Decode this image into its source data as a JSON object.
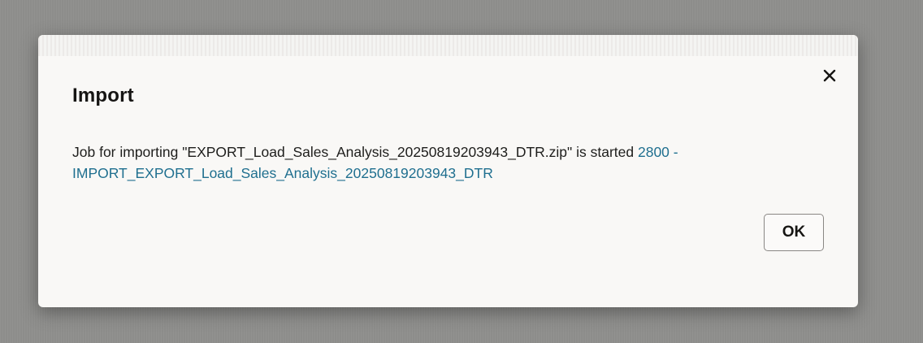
{
  "dialog": {
    "title": "Import",
    "close_icon": "close-icon",
    "message_prefix": "Job for importing \"EXPORT_Load_Sales_Analysis_20250819203943_DTR.zip\" is started ",
    "job_link_line1": "2800 -",
    "job_link_line2": "IMPORT_EXPORT_Load_Sales_Analysis_20250819203943_DTR",
    "ok_label": "OK"
  },
  "colors": {
    "backdrop": "#8f8f8d",
    "dialog_background": "#f9f8f6",
    "link": "#1f6f8f",
    "text": "#1e1e1c"
  }
}
